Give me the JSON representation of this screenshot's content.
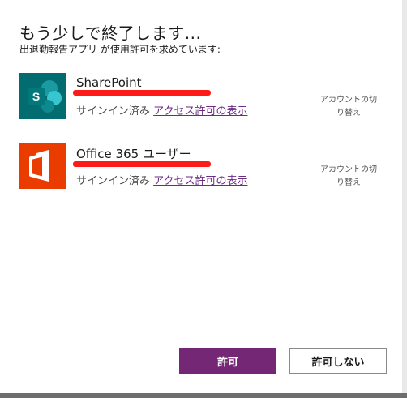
{
  "dialog": {
    "title": "もう少しで終了します...",
    "subtitle": "出退勤報告アプリ が使用許可を求めています:"
  },
  "connections": [
    {
      "service": "SharePoint",
      "icon": "sharepoint-icon",
      "signed_in_text": "サインイン済み",
      "permission_link": "アクセス許可の表示",
      "switch_account_line1": "アカウントの切",
      "switch_account_line2": "り替え"
    },
    {
      "service": "Office 365 ユーザー",
      "icon": "office365-icon",
      "signed_in_text": "サインイン済み",
      "permission_link": "アクセス許可の表示",
      "switch_account_line1": "アカウントの切",
      "switch_account_line2": "り替え"
    }
  ],
  "buttons": {
    "allow": "許可",
    "deny": "許可しない"
  },
  "colors": {
    "primary": "#742774",
    "link": "#6b2c82",
    "sharepoint": "#036c70",
    "office": "#eb3c00",
    "redaction": "#ff1a1a"
  }
}
